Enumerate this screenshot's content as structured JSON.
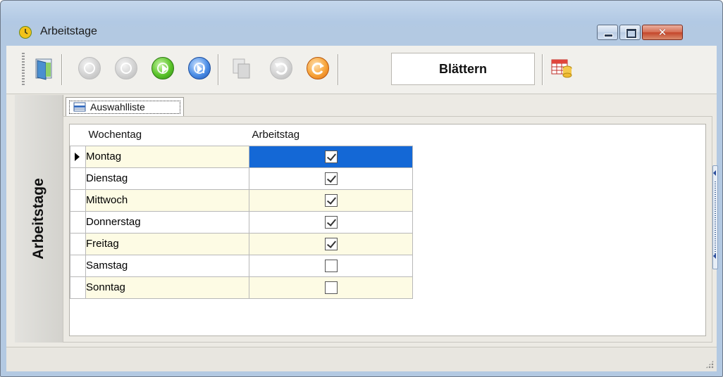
{
  "window": {
    "title": "Arbeitstage",
    "icon": "clock-icon",
    "controls": {
      "minimize": "minimize",
      "maximize": "maximize",
      "close": "close"
    }
  },
  "toolbar": {
    "buttons": [
      {
        "name": "exit-button",
        "icon": "door-exit-icon",
        "enabled": true
      },
      {
        "name": "first-record-button",
        "icon": "first-icon",
        "enabled": false
      },
      {
        "name": "previous-record-button",
        "icon": "previous-icon",
        "enabled": false
      },
      {
        "name": "next-record-button",
        "icon": "next-icon",
        "enabled": true
      },
      {
        "name": "last-record-button",
        "icon": "last-icon",
        "enabled": true
      },
      {
        "name": "copy-button",
        "icon": "copy-document-icon",
        "enabled": false
      },
      {
        "name": "undo-button",
        "icon": "undo-icon",
        "enabled": false
      },
      {
        "name": "refresh-button",
        "icon": "refresh-icon",
        "enabled": true
      },
      {
        "name": "table-database-button",
        "icon": "table-database-icon",
        "enabled": true
      }
    ],
    "mode_label": "Blättern"
  },
  "sidebar": {
    "vertical_title": "Arbeitstage"
  },
  "tabs": [
    {
      "label": "Auswahlliste",
      "icon": "list-icon",
      "active": true
    }
  ],
  "grid": {
    "columns": [
      "Wochentag",
      "Arbeitstag"
    ],
    "rows": [
      {
        "day": "Montag",
        "workday": true,
        "selected": true
      },
      {
        "day": "Dienstag",
        "workday": true,
        "selected": false
      },
      {
        "day": "Mittwoch",
        "workday": true,
        "selected": false
      },
      {
        "day": "Donnerstag",
        "workday": true,
        "selected": false
      },
      {
        "day": "Freitag",
        "workday": true,
        "selected": false
      },
      {
        "day": "Samstag",
        "workday": false,
        "selected": false
      },
      {
        "day": "Sonntag",
        "workday": false,
        "selected": false
      }
    ]
  },
  "colors": {
    "selection": "#1468d6",
    "alt_row": "#fdfbe4",
    "title_bar": "#b8cde6"
  }
}
